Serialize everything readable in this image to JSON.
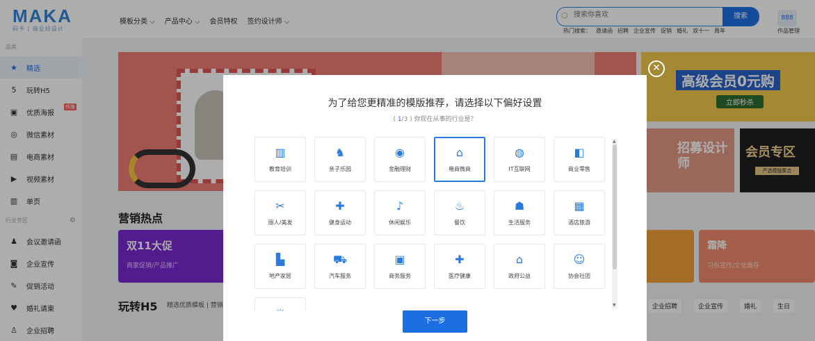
{
  "logo": {
    "main": "MAKA",
    "sub": "码卡 | 商业好设计"
  },
  "nav": [
    "模板分类 ⌵",
    "产品中心 ⌵",
    "会员特权",
    "签约设计师 ⌵"
  ],
  "search": {
    "placeholder": "搜索你喜欢",
    "button": "搜索",
    "hot_label": "热门搜索：",
    "hot": [
      "邀请函",
      "招聘",
      "企业宣传",
      "促销",
      "婚礼",
      "双十一",
      "周年"
    ]
  },
  "user": {
    "avatar": "888",
    "label": "作品管理"
  },
  "sidebar": {
    "section1": "品类",
    "items": [
      {
        "icon": "★",
        "label": "精选"
      },
      {
        "icon": "5",
        "label": "玩转H5"
      },
      {
        "icon": "▣",
        "label": "优质海报",
        "badge": "热推"
      },
      {
        "icon": "◎",
        "label": "微信素材"
      },
      {
        "icon": "▤",
        "label": "电商素材"
      },
      {
        "icon": "▶",
        "label": "视频素材"
      },
      {
        "icon": "▥",
        "label": "单页"
      }
    ],
    "section2": "行业专区",
    "items2": [
      {
        "icon": "♟",
        "label": "会议邀请函"
      },
      {
        "icon": "◙",
        "label": "企业宣传"
      },
      {
        "icon": "✎",
        "label": "促销活动"
      },
      {
        "icon": "♥",
        "label": "婚礼请柬"
      },
      {
        "icon": "♙",
        "label": "企业招聘"
      }
    ]
  },
  "main": {
    "banner2_title": "高级会员0元购",
    "banner2_btn": "立即秒杀",
    "banner3_title": "招募设计师",
    "banner4_title": "会员专区",
    "banner4_sub": "· 严选模版集合 ·",
    "marketing_title": "营销热点",
    "promo1_title": "双11大促",
    "promo1_sub": "商家促销/产品推广",
    "promo2_title": "霜降",
    "promo2_sub": "习俗宣传/文化倡导",
    "h5_title": "玩转H5",
    "h5_sub": "精选优质模板 | 营销",
    "tags": [
      "企业招聘",
      "企业宣传",
      "婚礼",
      "生日"
    ]
  },
  "modal": {
    "title": "为了给您更精准的模版推荐，请选择以下偏好设置",
    "step_open": "( ",
    "step_current": "1",
    "step_total": "/3",
    "step_close": " ) 你现在从事的行业是？",
    "close_icon": "✕",
    "next_button": "下一步",
    "selected": "电商微商",
    "industries": [
      {
        "icon": "▥",
        "label": "教育培训"
      },
      {
        "icon": "♞",
        "label": "亲子乐园"
      },
      {
        "icon": "◉",
        "label": "金融理财"
      },
      {
        "icon": "⌂",
        "label": "电商微商"
      },
      {
        "icon": "◍",
        "label": "IT互联网"
      },
      {
        "icon": "◧",
        "label": "商业零售"
      },
      {
        "icon": "✂",
        "label": "丽人/美发"
      },
      {
        "icon": "✚",
        "label": "健身运动"
      },
      {
        "icon": "♪",
        "label": "休闲娱乐"
      },
      {
        "icon": "♨",
        "label": "餐饮"
      },
      {
        "icon": "☗",
        "label": "生活服务"
      },
      {
        "icon": "▦",
        "label": "酒店旅游"
      },
      {
        "icon": "▙",
        "label": "地产家居"
      },
      {
        "icon": "⛟",
        "label": "汽车服务"
      },
      {
        "icon": "▣",
        "label": "商务服务"
      },
      {
        "icon": "✚",
        "label": "医疗健康"
      },
      {
        "icon": "⌂",
        "label": "政府公益"
      },
      {
        "icon": "☺",
        "label": "协会社团"
      },
      {
        "icon": "☼",
        "label": ""
      }
    ]
  }
}
